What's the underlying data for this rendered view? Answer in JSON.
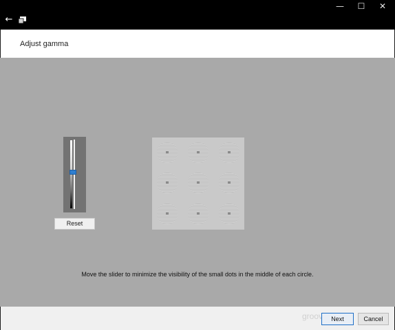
{
  "window": {
    "minimize_glyph": "—",
    "maximize_glyph": "☐",
    "close_glyph": "✕",
    "back_glyph": "←",
    "icons": [
      "back-arrow-icon",
      "app-icon",
      "minimize-icon",
      "maximize-icon",
      "close-icon"
    ]
  },
  "header": {
    "title": "Adjust gamma"
  },
  "slider": {
    "level": 0.47,
    "reset_label": "Reset",
    "accent_color": "#2f7fd0"
  },
  "instruction": "Move the slider to minimize the visibility of the small dots in the middle of each circle.",
  "footer": {
    "watermark": "groovy",
    "next_label": "Next",
    "cancel_label": "Cancel"
  },
  "colors": {
    "background": "#a9a9a9",
    "titlebar": "#000000",
    "accent": "#1c6ec7"
  }
}
